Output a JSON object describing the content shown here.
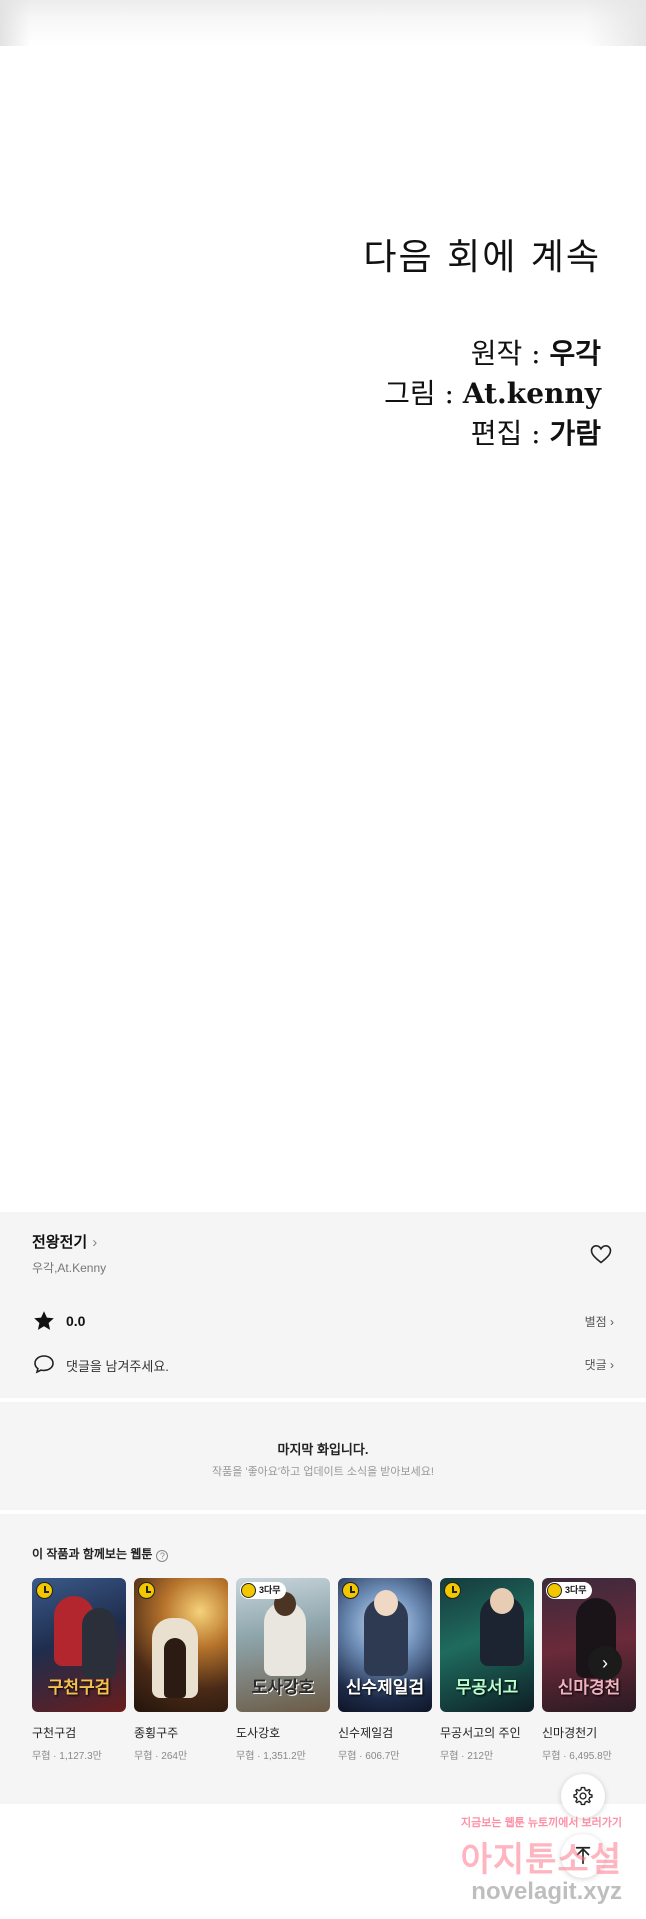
{
  "panel": {
    "to_be_continued": "다음 회에 계속",
    "credits": [
      {
        "role": "원작 : ",
        "name": "우각"
      },
      {
        "role": "그림 : ",
        "name": "At.kenny"
      },
      {
        "role": "편집 : ",
        "name": "가람"
      }
    ]
  },
  "info": {
    "series_title": "전왕전기",
    "authors": "우각,At.Kenny",
    "rating": "0.0",
    "rate_label": "별점 ›",
    "comment_placeholder": "댓글을 남겨주세요.",
    "comment_label": "댓글 ›"
  },
  "notice": {
    "title": "마지막 화입니다.",
    "subtitle": "작품을 '좋아요'하고 업데이트 소식을 받아보세요!"
  },
  "recommendations": {
    "title": "이 작품과 함께보는 웹툰",
    "items": [
      {
        "title": "구천구검",
        "meta": "무협 · 1,127.3만",
        "badge": "clock",
        "logo": "구천구검"
      },
      {
        "title": "종횡구주",
        "meta": "무협 · 264만",
        "badge": "clock",
        "logo": ""
      },
      {
        "title": "도사강호",
        "meta": "무협 · 1,351.2만",
        "badge": "3다무",
        "logo": "도사강호"
      },
      {
        "title": "신수제일검",
        "meta": "무협 · 606.7만",
        "badge": "clock",
        "logo": "신수제일검"
      },
      {
        "title": "무공서고의 주인",
        "meta": "무협 · 212만",
        "badge": "clock",
        "logo": "무공서고"
      },
      {
        "title": "신마경천기",
        "meta": "무협 · 6,495.8만",
        "badge": "3다무",
        "logo": "신마경천"
      }
    ]
  },
  "watermark": {
    "top": "지금보는 웹툰 뉴토끼에서 보러가기",
    "middle": "아지툰소설",
    "bottom": "novelagit.xyz"
  },
  "icons": [
    "heart-icon",
    "star-icon",
    "speech-bubble-icon",
    "chevron-right-icon",
    "settings-gear-icon",
    "arrow-up-icon",
    "help-icon",
    "clock-badge-icon"
  ],
  "colors": {
    "background": "#f5f5f5",
    "badge_yellow": "#f2c700",
    "next_button": "#1b1b1b"
  }
}
